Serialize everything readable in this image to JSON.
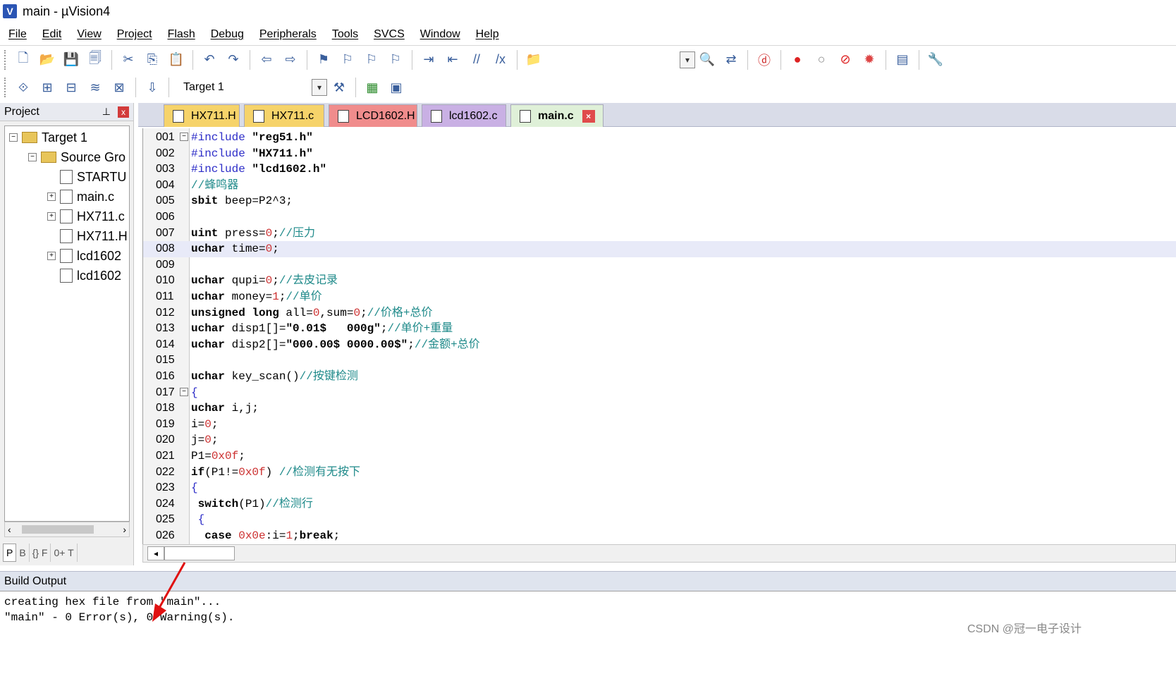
{
  "window": {
    "title": "main  - µVision4",
    "icon_letter": "V"
  },
  "menu": [
    "File",
    "Edit",
    "View",
    "Project",
    "Flash",
    "Debug",
    "Peripherals",
    "Tools",
    "SVCS",
    "Window",
    "Help"
  ],
  "toolbar1": {
    "icons": [
      "new-file-icon",
      "open-folder-icon",
      "save-icon",
      "save-all-icon",
      "cut-icon",
      "copy-icon",
      "paste-icon",
      "undo-icon",
      "redo-icon",
      "nav-back-icon",
      "nav-forward-icon",
      "bookmark-icon",
      "bookmark-prev-icon",
      "bookmark-next-icon",
      "bookmark-clear-icon",
      "indent-icon",
      "unindent-icon",
      "comment-icon",
      "uncomment-icon",
      "find-in-files-icon"
    ],
    "right_icons": [
      "find-icon",
      "replace-icon",
      "debug-start-icon",
      "breakpoint-icon",
      "breakpoint-disable-icon",
      "breakpoint-kill-icon",
      "breakpoint-kill-all-icon",
      "window-layout-icon",
      "config-wrench-icon"
    ]
  },
  "toolbar2": {
    "icons": [
      "translate-icon",
      "build-icon",
      "rebuild-icon",
      "batch-build-icon",
      "stop-build-icon",
      "load-icon"
    ],
    "target": "Target 1",
    "right_icons": [
      "target-options-icon",
      "manage-components-icon",
      "file-extensions-icon"
    ]
  },
  "project_panel": {
    "title": "Project",
    "pin_symbol": "📌",
    "close_symbol": "x",
    "tree": [
      {
        "label": "Target 1",
        "level": 0,
        "toggle": "⊟",
        "icon": "folder"
      },
      {
        "label": "Source Gro",
        "level": 1,
        "toggle": "⊟",
        "icon": "folder"
      },
      {
        "label": "STARTU",
        "level": 2,
        "toggle": "",
        "icon": "file"
      },
      {
        "label": "main.c",
        "level": 2,
        "toggle": "⊞",
        "icon": "file"
      },
      {
        "label": "HX711.c",
        "level": 2,
        "toggle": "⊞",
        "icon": "file"
      },
      {
        "label": "HX711.H",
        "level": 2,
        "toggle": "",
        "icon": "file"
      },
      {
        "label": "lcd1602",
        "level": 2,
        "toggle": "⊞",
        "icon": "file"
      },
      {
        "label": "lcd1602",
        "level": 2,
        "toggle": "",
        "icon": "file"
      }
    ],
    "bottom_tabs": [
      "P",
      "B",
      "{} F",
      "0+ T"
    ]
  },
  "editor_tabs": [
    {
      "label": "HX711.H",
      "color": "#f6d36a"
    },
    {
      "label": "HX711.c",
      "color": "#f6d36a"
    },
    {
      "label": "LCD1602.H",
      "color": "#f08c8c"
    },
    {
      "label": "lcd1602.c",
      "color": "#c9b0e4"
    },
    {
      "label": "main.c",
      "color": "#b8e4b8",
      "active": true
    }
  ],
  "code_lines": [
    {
      "n": "001",
      "html": "<span class='pp'>#include</span> <span class='str'>\"reg51.h\"</span>",
      "fold": "⊟"
    },
    {
      "n": "002",
      "html": "<span class='pp'>#include</span> <span class='str'>\"HX711.h\"</span>"
    },
    {
      "n": "003",
      "html": "<span class='pp'>#include</span> <span class='str'>\"lcd1602.h\"</span>"
    },
    {
      "n": "004",
      "html": "<span class='cmt'>//蜂鸣器</span>"
    },
    {
      "n": "005",
      "html": "<span class='kw'>sbit</span> beep=P2^3;"
    },
    {
      "n": "006",
      "html": ""
    },
    {
      "n": "007",
      "html": "<span class='kw'>uint</span> press=<span class='num'>0</span>;<span class='cmt'>//压力</span>"
    },
    {
      "n": "008",
      "html": "<span class='kw'>uchar</span> time=<span class='num'>0</span>;",
      "highlight": true
    },
    {
      "n": "009",
      "html": ""
    },
    {
      "n": "010",
      "html": "<span class='kw'>uchar</span> qupi=<span class='num'>0</span>;<span class='cmt'>//去皮记录</span>"
    },
    {
      "n": "011",
      "html": "<span class='kw'>uchar</span> money=<span class='num'>1</span>;<span class='cmt'>//单价</span>"
    },
    {
      "n": "012",
      "html": "<span class='kw'>unsigned</span> <span class='kw'>long</span> all=<span class='num'>0</span>,sum=<span class='num'>0</span>;<span class='cmt'>//价格+总价</span>"
    },
    {
      "n": "013",
      "html": "<span class='kw'>uchar</span> disp1[]=<span class='str'>\"0.01$   000g\"</span>;<span class='cmt'>//单价+重量</span>"
    },
    {
      "n": "014",
      "html": "<span class='kw'>uchar</span> disp2[]=<span class='str'>\"000.00$ 0000.00$\"</span>;<span class='cmt'>//金额+总价</span>"
    },
    {
      "n": "015",
      "html": ""
    },
    {
      "n": "016",
      "html": "<span class='kw'>uchar</span> key_scan()<span class='cmt'>//按键检测</span>"
    },
    {
      "n": "017",
      "html": "<span class='pp'>{</span>",
      "fold": "⊟"
    },
    {
      "n": "018",
      "html": "<span class='kw'>uchar</span> i,j;"
    },
    {
      "n": "019",
      "html": "i=<span class='num'>0</span>;"
    },
    {
      "n": "020",
      "html": "j=<span class='num'>0</span>;"
    },
    {
      "n": "021",
      "html": "P1=<span class='num'>0x0f</span>;"
    },
    {
      "n": "022",
      "html": "<span class='kw'>if</span>(P1!=<span class='num'>0x0f</span>) <span class='cmt'>//检测有无按下</span>"
    },
    {
      "n": "023",
      "html": "<span class='pp'>{</span>"
    },
    {
      "n": "024",
      "html": " <span class='kw'>switch</span>(P1)<span class='cmt'>//检测行</span>"
    },
    {
      "n": "025",
      "html": " <span class='pp'>{</span>"
    },
    {
      "n": "026",
      "html": "  <span class='kw'>case</span> <span class='num'>0x0e</span>:i=<span class='num'>1</span>;<span class='kw'>break</span>;"
    }
  ],
  "build_output": {
    "title": "Build Output",
    "lines": [
      "creating hex file from \"main\"...",
      "\"main\" - 0 Error(s), 0 Warning(s)."
    ]
  },
  "watermark": "CSDN @冠一电子设计",
  "colors": {
    "accent": "#2b55b4",
    "highlight_line": "#e8eaf8",
    "comment": "#1f8a8a",
    "number": "#cc3030",
    "arrow": "#e01010"
  }
}
